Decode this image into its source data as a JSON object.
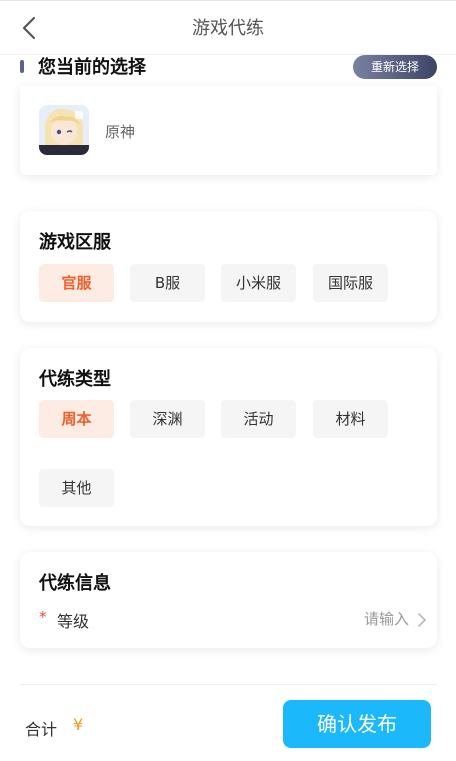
{
  "header": {
    "title": "游戏代练"
  },
  "selection": {
    "title": "您当前的选择",
    "reselect_label": "重新选择",
    "game_name": "原神"
  },
  "server": {
    "title": "游戏区服",
    "options": [
      "官服",
      "B服",
      "小米服",
      "国际服"
    ],
    "selected": "官服"
  },
  "service_type": {
    "title": "代练类型",
    "options": [
      "周本",
      "深渊",
      "活动",
      "材料",
      "其他"
    ],
    "selected": "周本"
  },
  "info": {
    "title": "代练信息",
    "required_mark": "*",
    "level_label": "等级",
    "level_placeholder": "请输入"
  },
  "footer": {
    "total_label": "合计",
    "currency": "¥",
    "submit_label": "确认发布"
  },
  "colors": {
    "accent": "#1bb8fb",
    "selected_chip_text": "#f0602a",
    "selected_chip_bg": "#fdece4",
    "required": "#e84d3d",
    "currency": "#f39a1a"
  }
}
